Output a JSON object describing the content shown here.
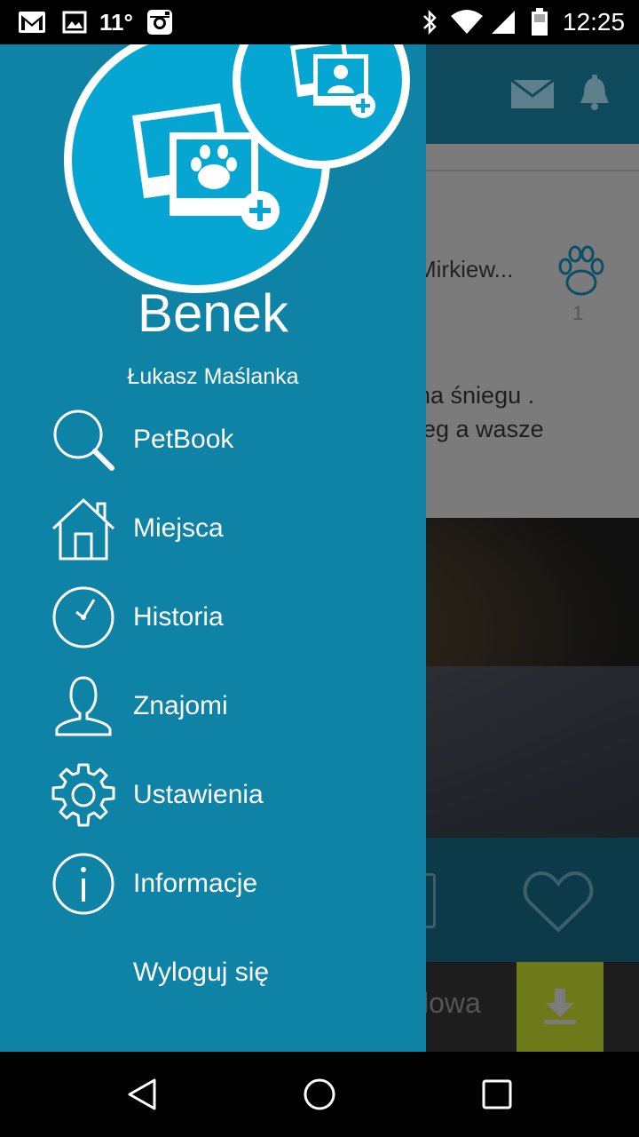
{
  "status_bar": {
    "temperature": "11°",
    "time": "12:25",
    "icons": [
      "gmail-icon",
      "image-icon",
      "instagram-icon",
      "bluetooth-icon",
      "wifi-icon",
      "signal-icon",
      "battery-icon"
    ]
  },
  "background": {
    "post_author": "Mirkiew...",
    "paw_count": "1",
    "post_line_1": "na śniegu .",
    "post_line_2": "ieg a wasze",
    "bottom_text": "lowa"
  },
  "drawer": {
    "pet_name": "Benek",
    "owner_name": "Łukasz Maślanka",
    "menu": [
      {
        "label": "PetBook",
        "icon": "search-icon"
      },
      {
        "label": "Miejsca",
        "icon": "home-icon"
      },
      {
        "label": "Historia",
        "icon": "clock-icon"
      },
      {
        "label": "Znajomi",
        "icon": "user-icon"
      },
      {
        "label": "Ustawienia",
        "icon": "gear-icon"
      },
      {
        "label": "Informacje",
        "icon": "info-icon"
      },
      {
        "label": "Wyloguj się",
        "icon": ""
      }
    ]
  },
  "nav_bar": {
    "buttons": [
      "back",
      "home",
      "recents"
    ]
  },
  "colors": {
    "drawer_bg": "#0e83a6",
    "avatar_bg": "#06a6d3",
    "download_button": "#6e7a1a"
  }
}
